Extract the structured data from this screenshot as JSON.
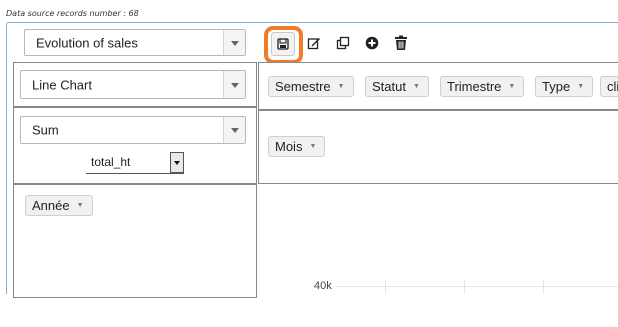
{
  "header": {
    "records_text": "Data source records number : 68"
  },
  "report_select": {
    "value": "Evolution of sales"
  },
  "toolbar": {
    "save_icon": "save-icon",
    "edit_icon": "edit-icon",
    "copy_icon": "copy-icon",
    "add_icon": "add-icon",
    "delete_icon": "trash-icon",
    "highlight_color": "#f07c2a"
  },
  "renderer_select": {
    "value": "Line Chart"
  },
  "aggregator_select": {
    "value": "Sum"
  },
  "attribute_select": {
    "value": "total_ht"
  },
  "column_fields": [
    {
      "label": "Semestre"
    },
    {
      "label": "Statut"
    },
    {
      "label": "Trimestre"
    },
    {
      "label": "Type"
    },
    {
      "label": "cli"
    }
  ],
  "row_fields": [
    {
      "label": "Mois"
    }
  ],
  "unused_fields": [
    {
      "label": "Année"
    }
  ],
  "chart_preview": {
    "y_tick_label": "40k"
  }
}
